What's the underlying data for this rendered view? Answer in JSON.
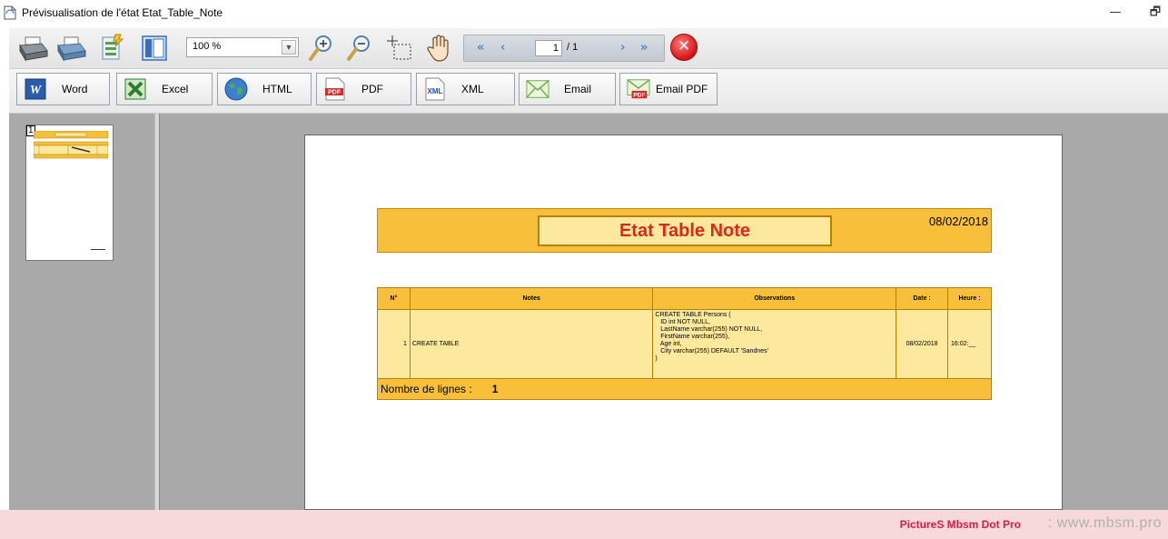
{
  "window": {
    "title": "Prévisualisation de l'état Etat_Table_Note",
    "minimize_glyph": "—",
    "restore_glyph": "🗗"
  },
  "toolbar": {
    "zoom_value": "100 %",
    "page_current": "1",
    "page_total": "/ 1",
    "icons": [
      "print-icon",
      "print-setup-icon",
      "quick-print-icon",
      "thumbnails-icon",
      "zoom-in-icon",
      "zoom-out-icon",
      "zoom-area-icon",
      "hand-pan-icon",
      "first-page-icon",
      "previous-page-icon",
      "next-page-icon",
      "last-page-icon",
      "close-icon"
    ],
    "nav_first": "«",
    "nav_prev": "‹",
    "nav_next": "›",
    "nav_last": "»",
    "close_glyph": "✕"
  },
  "export": {
    "word": "Word",
    "excel": "Excel",
    "html": "HTML",
    "pdf": "PDF",
    "xml": "XML",
    "email": "Email",
    "email_pdf": "Email PDF",
    "icon_word": "W",
    "icon_pdf": "PDF",
    "icon_xml": "XML",
    "icon_email_pdf": "PDF"
  },
  "thumbnail": {
    "page_number": "1"
  },
  "report": {
    "title": "Etat Table Note",
    "date": "08/02/2018",
    "columns": [
      "N°",
      "Notes",
      "Observations",
      "Date :",
      "Heure :"
    ],
    "rows": [
      {
        "num": "1",
        "note": "CREATE TABLE",
        "observation": "CREATE TABLE Persons (\n   ID int NOT NULL,\n   LastName varchar(255) NOT NULL,\n   FirstName varchar(255),\n   Age int,\n   City varchar(255) DEFAULT 'Sandnes'\n)",
        "date": "08/02/2018",
        "heure": "16:02:__"
      }
    ],
    "footer_label": "Nombre de lignes :",
    "footer_value": "1"
  },
  "watermark": {
    "left": "PictureS Mbsm Dot Pro",
    "right": ": www.mbsm.pro"
  },
  "colors": {
    "report_orange": "#f8c03a",
    "report_light": "#fde99e",
    "title_red": "#e0261b",
    "watermark_bg": "#f7d9d9"
  }
}
